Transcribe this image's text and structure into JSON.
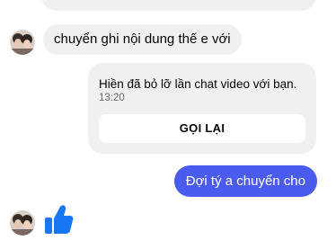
{
  "messages": {
    "incoming_text": "chuyển ghi nội dung thế e với",
    "missed_call": {
      "text": "Hiền đã bỏ lỡ lần chat video với bạn.",
      "time": "13:20",
      "button_label": "GỌI LẠI"
    },
    "outgoing_text": "Đợi tý a chuyển cho"
  },
  "icons": {
    "like": "thumbs-up-icon"
  },
  "colors": {
    "outgoing_bubble": "#4a5cf0",
    "incoming_bubble": "#f0f0f0",
    "like_icon": "#1877f2"
  }
}
